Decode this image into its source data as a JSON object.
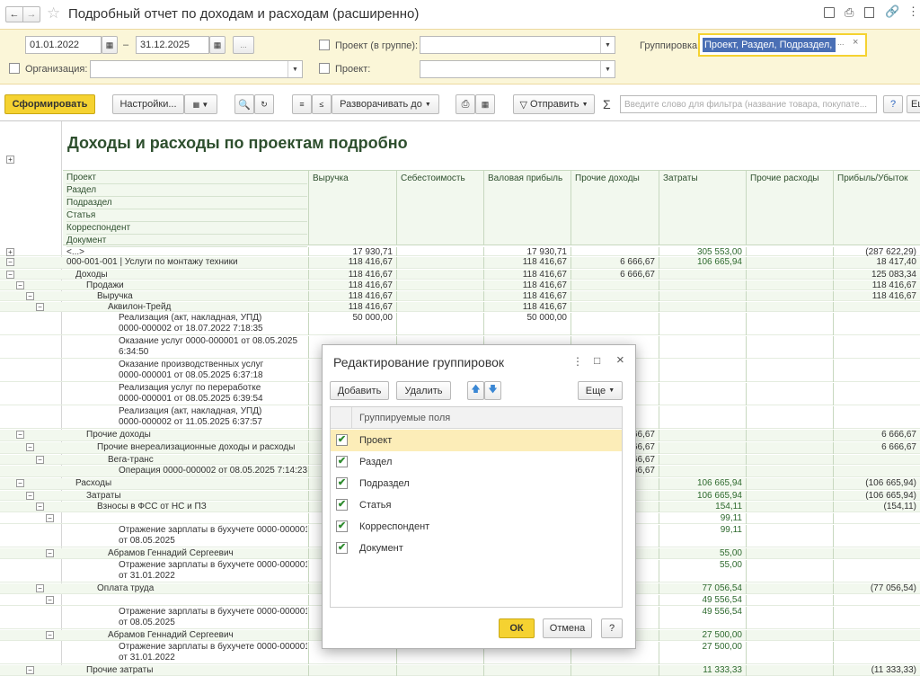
{
  "window": {
    "title": "Подробный отчет по доходам и расходам (расширенно)"
  },
  "filters": {
    "date_from": "01.01.2022",
    "date_sep": "–",
    "date_to": "31.12.2025",
    "ellipsis": "...",
    "org_label": "Организация:",
    "org_value": "",
    "project_group_label": "Проект (в группе):",
    "project_label": "Проект:",
    "grouping_label": "Группировка:",
    "grouping_value": "Проект, Раздел, Подраздел,",
    "grouping_more": "...",
    "grouping_clear": "×"
  },
  "toolbar": {
    "generate": "Сформировать",
    "settings": "Настройки...",
    "expand": "Разворачивать до",
    "send": "Отправить",
    "sigma": "Σ",
    "search_placeholder": "Введите слово для фильтра (название товара, покупате...",
    "help": "?",
    "more": "Ещ"
  },
  "report": {
    "title": "Доходы и расходы по проектам подробно",
    "group_headers": [
      "Проект",
      "Раздел",
      "Подраздел",
      "Статья",
      "Корреспондент",
      "Документ"
    ],
    "columns": [
      "Выручка",
      "Себестоимость",
      "Валовая прибыль",
      "Прочие доходы",
      "Затраты",
      "Прочие расходы",
      "Прибыль/Убыток"
    ],
    "rows": [
      {
        "label": "<...>",
        "c": [
          "17 930,71",
          "",
          "17 930,71",
          "",
          "305 553,00",
          "",
          "(287 622,29)"
        ]
      },
      {
        "label": "000-001-001 | Услуги по монтажу техники",
        "c": [
          "118 416,67",
          "",
          "118 416,67",
          "6 666,67",
          "106 665,94",
          "",
          "18 417,40"
        ]
      },
      {
        "label": "Доходы",
        "c": [
          "118 416,67",
          "",
          "118 416,67",
          "6 666,67",
          "",
          "",
          "125 083,34"
        ]
      },
      {
        "label": "Продажи",
        "c": [
          "118 416,67",
          "",
          "118 416,67",
          "",
          "",
          "",
          "118 416,67"
        ]
      },
      {
        "label": "Выручка",
        "c": [
          "118 416,67",
          "",
          "118 416,67",
          "",
          "",
          "",
          "118 416,67"
        ]
      },
      {
        "label": "Аквилон-Трейд",
        "c": [
          "118 416,67",
          "",
          "118 416,67",
          "",
          "",
          "",
          ""
        ]
      },
      {
        "label": "Реализация (акт, накладная, УПД)\n0000-000002 от 18.07.2022 7:18:35",
        "c": [
          "50 000,00",
          "",
          "50 000,00",
          "",
          "",
          "",
          ""
        ]
      },
      {
        "label": "Оказание услуг 0000-000001 от 08.05.2025\n6:34:50",
        "c": [
          "",
          "",
          "",
          "",
          "",
          "",
          ""
        ]
      },
      {
        "label": "Оказание производственных услуг\n0000-000001 от 08.05.2025 6:37:18",
        "c": [
          "",
          "",
          "",
          "",
          "",
          "",
          ""
        ]
      },
      {
        "label": "Реализация услуг по переработке\n0000-000001 от 08.05.2025 6:39:54",
        "c": [
          "",
          "",
          "",
          "",
          "",
          "",
          ""
        ]
      },
      {
        "label": "Реализация (акт, накладная, УПД)\n0000-000002 от 11.05.2025 6:37:57",
        "c": [
          "",
          "",
          "",
          "",
          "",
          "",
          ""
        ]
      },
      {
        "label": "Прочие доходы",
        "c": [
          "",
          "",
          "",
          "66,67",
          "",
          "",
          "6 666,67"
        ]
      },
      {
        "label": "Прочие внереализационные доходы и расходы",
        "c": [
          "",
          "",
          "",
          "66,67",
          "",
          "",
          "6 666,67"
        ]
      },
      {
        "label": "Вега-транс",
        "c": [
          "",
          "",
          "",
          "66,67",
          "",
          "",
          ""
        ]
      },
      {
        "label": "Операция 0000-000002 от 08.05.2025 7:14:23",
        "c": [
          "",
          "",
          "",
          "66,67",
          "",
          "",
          ""
        ]
      },
      {
        "label": "Расходы",
        "c": [
          "",
          "",
          "",
          "",
          "106 665,94",
          "",
          "(106 665,94)"
        ]
      },
      {
        "label": "Затраты",
        "c": [
          "",
          "",
          "",
          "",
          "106 665,94",
          "",
          "(106 665,94)"
        ]
      },
      {
        "label": "Взносы в ФСС от НС и ПЗ",
        "c": [
          "",
          "",
          "",
          "",
          "154,11",
          "",
          "(154,11)"
        ]
      },
      {
        "label": "",
        "c": [
          "",
          "",
          "",
          "",
          "99,11",
          "",
          ""
        ]
      },
      {
        "label": "Отражение зарплаты в бухучете 0000-000001\nот 08.05.2025",
        "c": [
          "",
          "",
          "",
          "",
          "99,11",
          "",
          ""
        ]
      },
      {
        "label": "Абрамов Геннадий Сергеевич",
        "c": [
          "",
          "",
          "",
          "",
          "55,00",
          "",
          ""
        ]
      },
      {
        "label": "Отражение зарплаты в бухучете 0000-000001\nот 31.01.2022",
        "c": [
          "",
          "",
          "",
          "",
          "55,00",
          "",
          ""
        ]
      },
      {
        "label": "Оплата труда",
        "c": [
          "",
          "",
          "",
          "",
          "77 056,54",
          "",
          "(77 056,54)"
        ]
      },
      {
        "label": "",
        "c": [
          "",
          "",
          "",
          "",
          "49 556,54",
          "",
          ""
        ]
      },
      {
        "label": "Отражение зарплаты в бухучете 0000-000001\nот 08.05.2025",
        "c": [
          "",
          "",
          "",
          "",
          "49 556,54",
          "",
          ""
        ]
      },
      {
        "label": "Абрамов Геннадий Сергеевич",
        "c": [
          "",
          "",
          "",
          "",
          "27 500,00",
          "",
          ""
        ]
      },
      {
        "label": "Отражение зарплаты в бухучете 0000-000001\nот 31.01.2022",
        "c": [
          "",
          "",
          "",
          "",
          "27 500,00",
          "",
          ""
        ]
      },
      {
        "label": "Прочие затраты",
        "c": [
          "",
          "",
          "",
          "",
          "11 333,33",
          "",
          "(11 333,33)"
        ]
      }
    ],
    "partial_values": {
      "r7": "0 000,00",
      "r7b": "0 000,00"
    }
  },
  "dialog": {
    "title": "Редактирование группировок",
    "menu": "⋮",
    "maximize": "□",
    "close": "×",
    "add": "Добавить",
    "delete": "Удалить",
    "more": "Еще",
    "column_header": "Группируемые поля",
    "fields": [
      {
        "label": "Проект",
        "checked": true
      },
      {
        "label": "Раздел",
        "checked": true
      },
      {
        "label": "Подраздел",
        "checked": true
      },
      {
        "label": "Статья",
        "checked": true
      },
      {
        "label": "Корреспондент",
        "checked": true
      },
      {
        "label": "Документ",
        "checked": true
      }
    ],
    "ok": "ОК",
    "cancel": "Отмена",
    "help": "?"
  },
  "colors": {
    "accent": "#f5d231",
    "selection": "#4a6fb5",
    "header_bg": "#f2f8ee",
    "green_text": "#2e4f2e"
  }
}
